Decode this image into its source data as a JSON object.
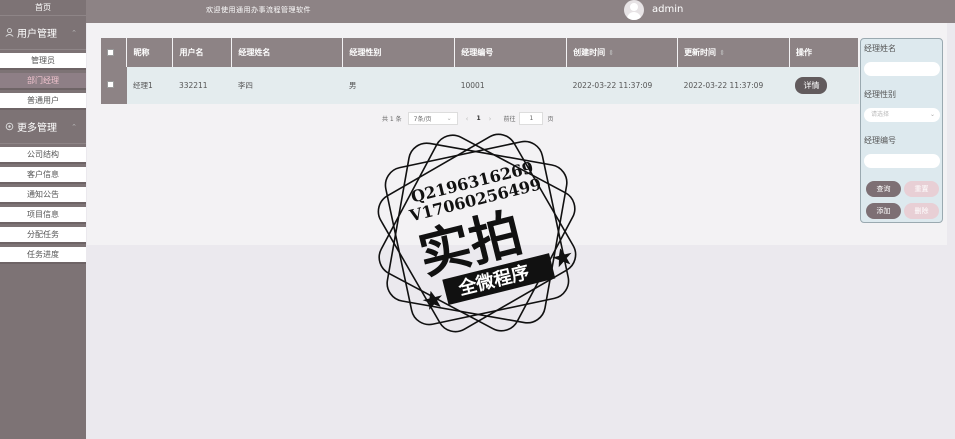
{
  "sidebar": {
    "home": "首页",
    "groups": [
      {
        "title": "用户管理",
        "items": [
          {
            "label": "管理员",
            "active": false
          },
          {
            "label": "部门经理",
            "active": true
          },
          {
            "label": "普通用户",
            "active": false
          }
        ]
      },
      {
        "title": "更多管理",
        "items": [
          {
            "label": "公司结构",
            "active": false
          },
          {
            "label": "客户信息",
            "active": false
          },
          {
            "label": "通知公告",
            "active": false
          },
          {
            "label": "项目信息",
            "active": false
          },
          {
            "label": "分配任务",
            "active": false
          },
          {
            "label": "任务进度",
            "active": false
          }
        ]
      }
    ]
  },
  "header": {
    "title": "欢迎使用通用办事流程管理软件",
    "username": "admin"
  },
  "table": {
    "columns": [
      "昵称",
      "用户名",
      "经理姓名",
      "经理性别",
      "经理编号",
      "创建时间",
      "更新时间",
      "操作"
    ],
    "rows": [
      {
        "nickname": "经理1",
        "username": "332211",
        "name": "李四",
        "gender": "男",
        "number": "10001",
        "created": "2022-03-22 11:37:09",
        "updated": "2022-03-22 11:37:09",
        "action": "详情"
      }
    ]
  },
  "pager": {
    "total": "共 1 条",
    "page_size": "7条/页",
    "current_page": "1",
    "goto_label": "前往",
    "goto_value": "1",
    "page_suffix": "页"
  },
  "search": {
    "name_label": "经理姓名",
    "name_value": "",
    "gender_label": "经理性别",
    "gender_placeholder": "请选择",
    "number_label": "经理编号",
    "number_value": "",
    "buttons": {
      "query": "查询",
      "reset": "重置",
      "add": "添加",
      "delete": "删除"
    }
  },
  "watermark": {
    "line1": "Q2196316269",
    "line2": "V17060256499",
    "main": "实拍",
    "banner": "全微程序"
  },
  "colors": {
    "sidebar": "#7d7375",
    "header": "#8d8385",
    "active_item_text": "#f0c3ce",
    "row_bg": "#e4ecee",
    "search_panel": "#dde9ee"
  }
}
